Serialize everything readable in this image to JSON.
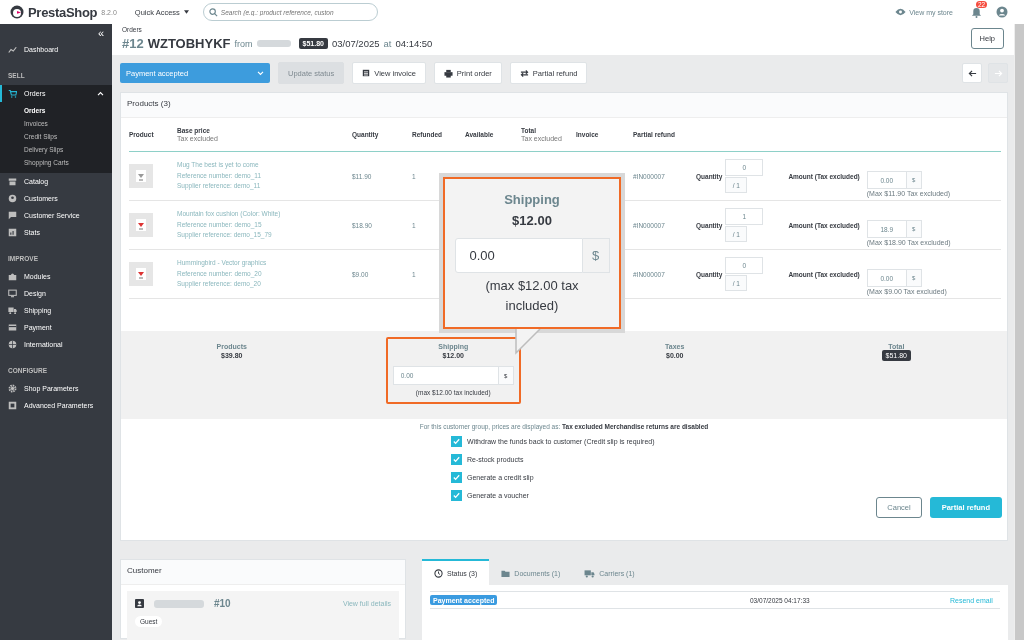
{
  "topbar": {
    "brand": "PrestaShop",
    "version": "8.2.0",
    "quick_access": "Quick Access",
    "search": {
      "placeholder": "Search (e.g.: product reference, custon"
    },
    "view_store": "View my store",
    "notifications": "22"
  },
  "sidebar": {
    "collapse": "«",
    "items": [
      {
        "kind": "link",
        "label": "Dashboard"
      },
      {
        "kind": "section",
        "label": "SELL"
      },
      {
        "kind": "group",
        "label": "Orders",
        "expanded": true,
        "children": [
          {
            "label": "Orders",
            "selected": true
          },
          {
            "label": "Invoices",
            "selected": false
          },
          {
            "label": "Credit Slips",
            "selected": false
          },
          {
            "label": "Delivery Slips",
            "selected": false
          },
          {
            "label": "Shopping Carts",
            "selected": false
          }
        ]
      },
      {
        "kind": "link",
        "label": "Catalog"
      },
      {
        "kind": "link",
        "label": "Customers"
      },
      {
        "kind": "link",
        "label": "Customer Service"
      },
      {
        "kind": "link",
        "label": "Stats"
      },
      {
        "kind": "section",
        "label": "IMPROVE"
      },
      {
        "kind": "link",
        "label": "Modules"
      },
      {
        "kind": "link",
        "label": "Design"
      },
      {
        "kind": "link",
        "label": "Shipping"
      },
      {
        "kind": "link",
        "label": "Payment"
      },
      {
        "kind": "link",
        "label": "International"
      },
      {
        "kind": "section",
        "label": "CONFIGURE"
      },
      {
        "kind": "link",
        "label": "Shop Parameters"
      },
      {
        "kind": "link",
        "label": "Advanced Parameters"
      }
    ]
  },
  "header": {
    "breadcrumb": "Orders",
    "order_number": "#12",
    "reference": "WZTOBHYKF",
    "from": "from",
    "total": "$51.80",
    "date": "03/07/2025",
    "at": "at",
    "time": "04:14:50",
    "help": "Help"
  },
  "toolbar": {
    "status": "Payment accepted",
    "buttons": [
      {
        "kind": "plain",
        "label": "Update status",
        "disabled": true
      },
      {
        "kind": "invoice",
        "label": "View invoice",
        "disabled": false
      },
      {
        "kind": "print",
        "label": "Print order",
        "disabled": false
      },
      {
        "kind": "refund",
        "label": "Partial refund",
        "disabled": false
      }
    ],
    "nav": [
      {
        "kind": "prev",
        "disabled": false
      },
      {
        "kind": "next",
        "disabled": true
      }
    ]
  },
  "products": {
    "title": "Products (3)",
    "columns": [
      {
        "label": "Product"
      },
      {
        "label": "Base price",
        "note": "Tax excluded"
      },
      {
        "label": "Quantity"
      },
      {
        "label": "Refunded"
      },
      {
        "label": "Available"
      },
      {
        "label": "Total",
        "note": "Tax excluded"
      },
      {
        "label": "Invoice"
      },
      {
        "label": "Partial refund"
      }
    ],
    "rows": [
      {
        "name": "Mug The best is yet to come",
        "reference": "Reference number: demo_11",
        "supplier": "Supplier reference: demo_11",
        "base_price": "$11.90",
        "quantity": "1",
        "invoice": "#IN000007",
        "quantity_label": "Quantity",
        "refund_quantity": "0",
        "max_quantity": "/ 1",
        "amount_label": "Amount (Tax excluded)",
        "amount": "0.00",
        "currency": "$",
        "max_amount": "(Max $11.90 Tax excluded)"
      },
      {
        "name": "Mountain fox cushion (Color: White)",
        "reference": "Reference number: demo_15",
        "supplier": "Supplier reference: demo_15_79",
        "base_price": "$18.90",
        "quantity": "1",
        "invoice": "#IN000007",
        "quantity_label": "Quantity",
        "refund_quantity": "1",
        "max_quantity": "/ 1",
        "amount_label": "Amount (Tax excluded)",
        "amount": "18.9",
        "currency": "$",
        "max_amount": "(Max $18.90 Tax excluded)"
      },
      {
        "name": "Hummingbird - Vector graphics",
        "reference": "Reference number: demo_20",
        "supplier": "Supplier reference: demo_20",
        "base_price": "$9.00",
        "quantity": "1",
        "invoice": "#IN000007",
        "quantity_label": "Quantity",
        "refund_quantity": "0",
        "max_quantity": "/ 1",
        "amount_label": "Amount (Tax excluded)",
        "amount": "0.00",
        "currency": "$",
        "max_amount": "(Max $9.00 Tax excluded)"
      }
    ],
    "summary": [
      {
        "kind": "plain",
        "label": "Products",
        "value": "$39.80",
        "highlighted": false
      },
      {
        "kind": "refund",
        "label": "Shipping",
        "value": "$12.00",
        "input": "0.00",
        "currency": "$",
        "max": "(max $12.00 tax included)",
        "highlighted": true
      },
      {
        "kind": "plain",
        "label": "Taxes",
        "value": "$0.00",
        "highlighted": false
      },
      {
        "kind": "badge",
        "label": "Total",
        "value": "$51.80",
        "highlighted": false
      }
    ],
    "note": "For this customer group, prices are displayed as: **Tax excluded**  **Merchandise returns are disabled**",
    "options": [
      {
        "label": "Withdraw the funds back to customer (Credit slip is required)",
        "checked": true
      },
      {
        "label": "Re-stock products",
        "checked": true
      },
      {
        "label": "Generate a credit slip",
        "checked": true
      },
      {
        "label": "Generate a voucher",
        "checked": true
      }
    ],
    "cancel": "Cancel",
    "submit": "Partial refund"
  },
  "callout": {
    "label": "Shipping",
    "value": "$12.00",
    "input": "0.00",
    "currency": "$",
    "max": "(max $12.00 tax included)"
  },
  "customer": {
    "title": "Customer",
    "id": "#10",
    "details": "View full details",
    "badge": "Guest"
  },
  "history": {
    "tabs": [
      {
        "kind": "status",
        "label": "Status (3)",
        "selected": true
      },
      {
        "kind": "documents",
        "label": "Documents (1)",
        "selected": false
      },
      {
        "kind": "carriers",
        "label": "Carriers (1)",
        "selected": false
      }
    ],
    "rows": [
      {
        "status": "Payment accepted",
        "color": "#3a9be0",
        "date": "03/07/2025 04:17:33",
        "action": "Resend email"
      }
    ]
  }
}
